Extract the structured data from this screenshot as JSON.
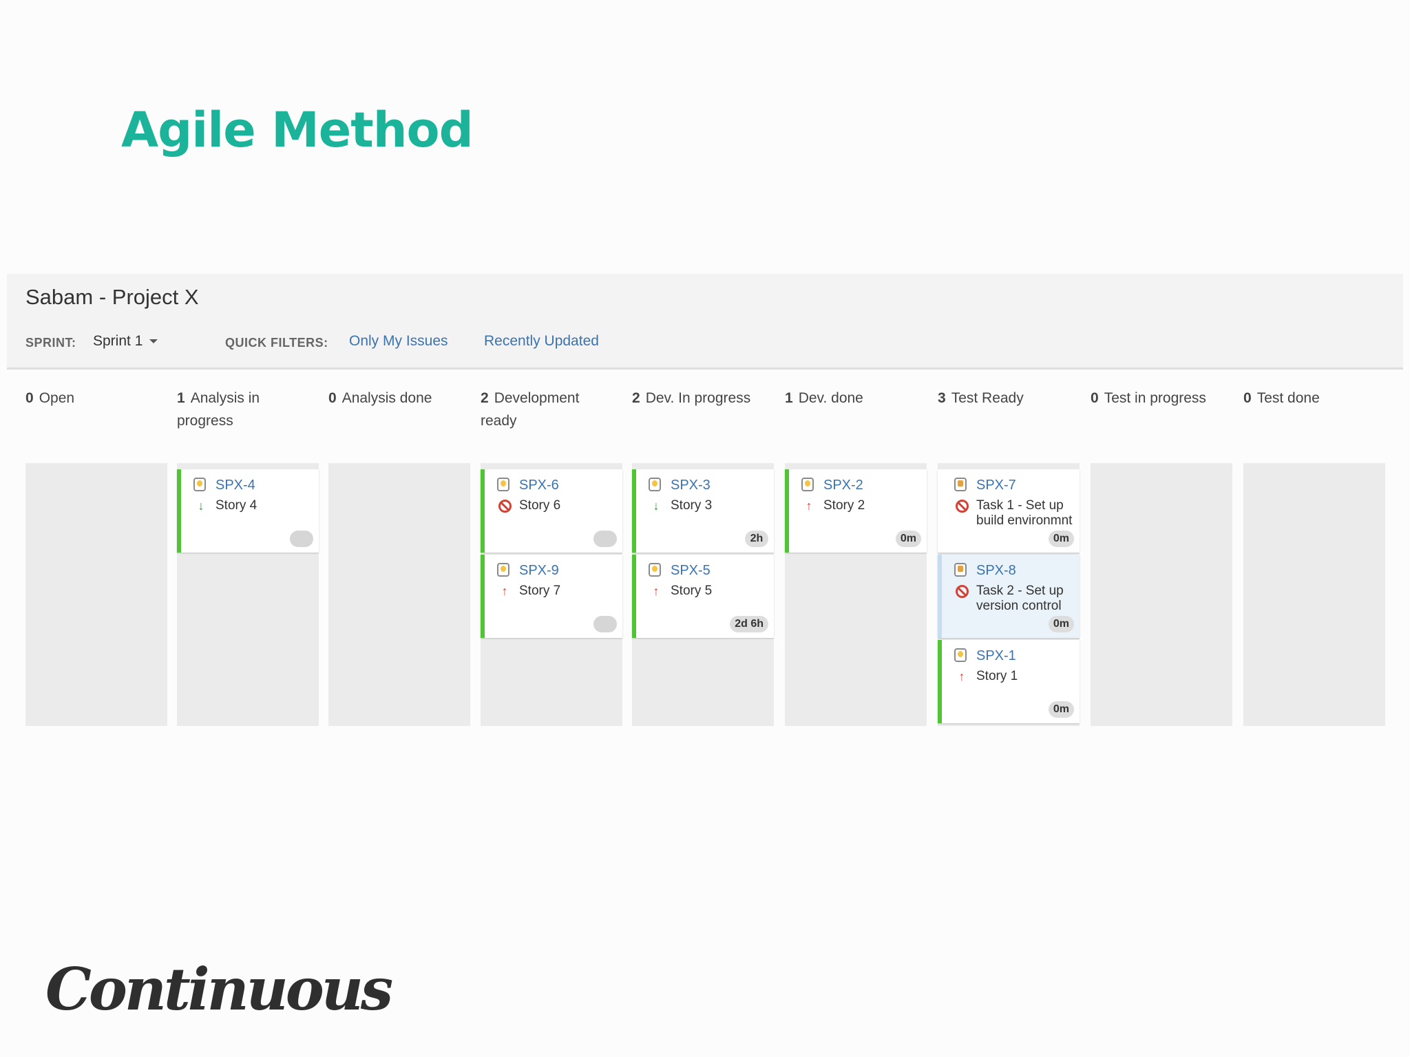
{
  "slide": {
    "title": "Agile Method"
  },
  "board": {
    "title": "Sabam - Project X",
    "sprint_label": "SPRINT:",
    "sprint_value": "Sprint 1",
    "quick_filters_label": "QUICK FILTERS:",
    "filters": [
      "Only My Issues",
      "Recently Updated"
    ]
  },
  "columns": [
    {
      "count": "0",
      "name": "Open",
      "cards": []
    },
    {
      "count": "1",
      "name": "Analysis in progress",
      "cards": [
        {
          "key": "SPX-4",
          "summary": "Story 4",
          "type": "story",
          "priority": "low",
          "estimate": "",
          "style": "green"
        }
      ]
    },
    {
      "count": "0",
      "name": "Analysis done",
      "cards": []
    },
    {
      "count": "2",
      "name": "Development ready",
      "cards": [
        {
          "key": "SPX-6",
          "summary": "Story 6",
          "type": "story",
          "priority": "blocker",
          "estimate": "",
          "style": "green"
        },
        {
          "key": "SPX-9",
          "summary": "Story 7",
          "type": "story",
          "priority": "high",
          "estimate": "",
          "style": "green"
        }
      ]
    },
    {
      "count": "2",
      "name": "Dev. In progress",
      "cards": [
        {
          "key": "SPX-3",
          "summary": "Story 3",
          "type": "story",
          "priority": "low",
          "estimate": "2h",
          "style": "green"
        },
        {
          "key": "SPX-5",
          "summary": "Story 5",
          "type": "story",
          "priority": "high",
          "estimate": "2d 6h",
          "style": "green"
        }
      ]
    },
    {
      "count": "1",
      "name": "Dev. done",
      "cards": [
        {
          "key": "SPX-2",
          "summary": "Story 2",
          "type": "story",
          "priority": "high",
          "estimate": "0m",
          "style": "green"
        }
      ]
    },
    {
      "count": "3",
      "name": "Test Ready",
      "cards": [
        {
          "key": "SPX-7",
          "summary": "Task 1 - Set up build environmnt",
          "type": "task",
          "priority": "blocker",
          "estimate": "0m",
          "style": "plain"
        },
        {
          "key": "SPX-8",
          "summary": "Task 2 - Set up version control",
          "type": "task",
          "priority": "blocker",
          "estimate": "0m",
          "style": "blue"
        },
        {
          "key": "SPX-1",
          "summary": "Story 1",
          "type": "story",
          "priority": "high",
          "estimate": "0m",
          "style": "green"
        }
      ]
    },
    {
      "count": "0",
      "name": "Test in progress",
      "cards": []
    },
    {
      "count": "0",
      "name": "Test done",
      "cards": []
    }
  ],
  "logo": {
    "text": "Continuous"
  },
  "icons": {
    "story": "story-type-icon",
    "task": "task-type-icon",
    "priority_low": "arrow-down-icon",
    "priority_high": "arrow-up-icon",
    "priority_blocker": "blocker-icon",
    "sprint_dropdown": "chevron-down-icon"
  },
  "colors": {
    "title": "#1bb39a",
    "link": "#3b73af",
    "card_accent": "#51c435",
    "priority_high": "#d04437",
    "priority_low": "#2c9a3c"
  }
}
